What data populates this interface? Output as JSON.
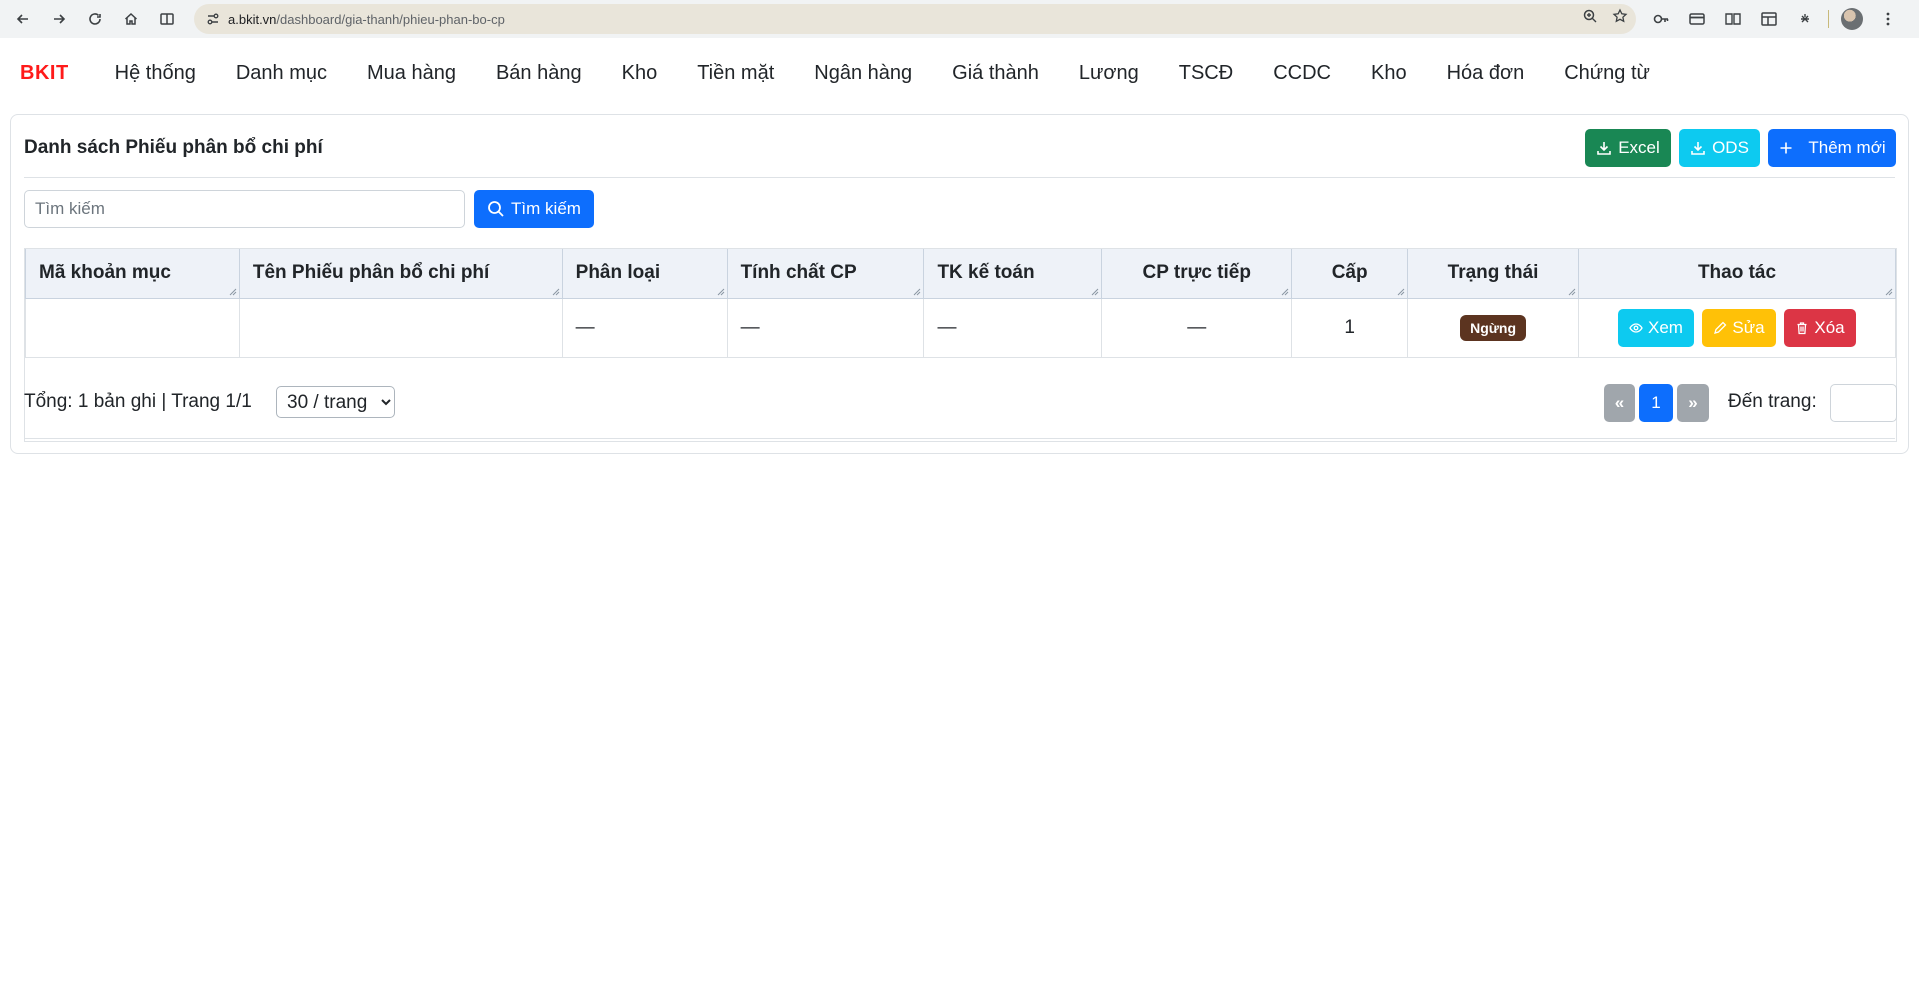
{
  "browser": {
    "url_host": "a.bkit.vn",
    "url_path": "/dashboard/gia-thanh/phieu-phan-bo-cp"
  },
  "app": {
    "brand": "BKIT",
    "brand_color": "#ff1a1a",
    "menu": [
      "Hệ thống",
      "Danh mục",
      "Mua hàng",
      "Bán hàng",
      "Kho",
      "Tiền mặt",
      "Ngân hàng",
      "Giá thành",
      "Lương",
      "TSCĐ",
      "CCDC",
      "Kho",
      "Hóa đơn",
      "Chứng từ"
    ]
  },
  "page": {
    "title": "Danh sách Phiếu phân bổ chi phí",
    "excel_label": "Excel",
    "ods_label": "ODS",
    "add_label": "Thêm mới",
    "search_placeholder": "Tìm kiếm",
    "search_button": "Tìm kiếm"
  },
  "table": {
    "columns": [
      "Mã khoản mục",
      "Tên Phiếu phân bổ chi phí",
      "Phân loại",
      "Tính chất CP",
      "TK kế toán",
      "CP trực tiếp",
      "Cấp",
      "Trạng thái",
      "Thao tác"
    ],
    "rows": [
      {
        "ma": "",
        "ten": "",
        "phan_loai": "—",
        "tinh_chat": "—",
        "tk": "—",
        "cp_truc_tiep": "—",
        "cap": "1",
        "trang_thai": "Ngừng",
        "view": "Xem",
        "edit": "Sửa",
        "delete": "Xóa"
      }
    ]
  },
  "footer": {
    "summary": "Tổng: 1 bản ghi | Trang 1/1",
    "page_size": "30 / trang",
    "prev": "«",
    "current_page": "1",
    "next": "»",
    "goto_label": "Đến trang:"
  },
  "colors": {
    "primary": "#0d6efd",
    "success": "#198754",
    "info": "#0dcaf0",
    "warning": "#ffc107",
    "danger": "#dc3545",
    "status_stopped": "#5c3420"
  }
}
